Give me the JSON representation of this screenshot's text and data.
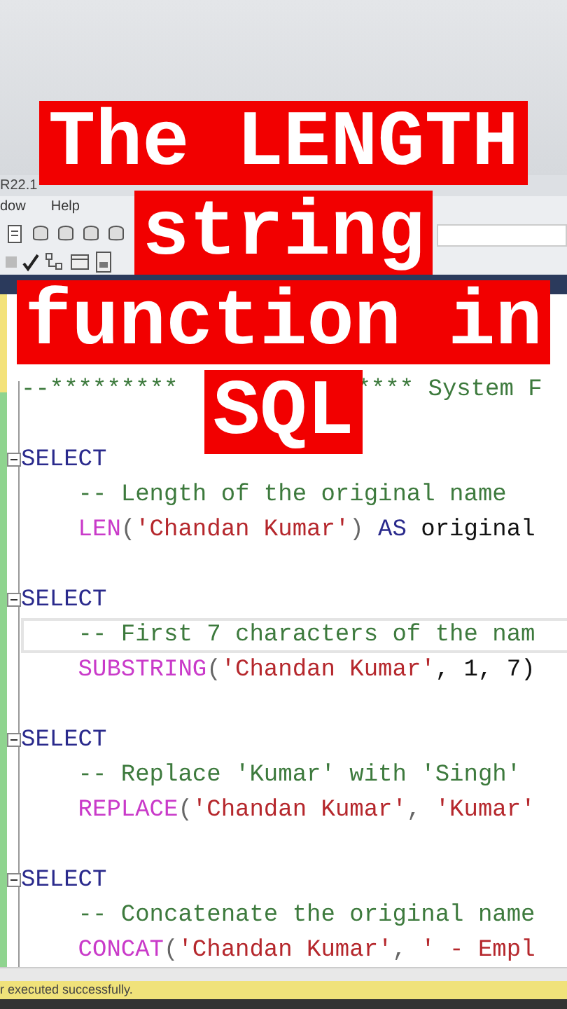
{
  "window": {
    "title": "R22.1"
  },
  "menu": [
    "dow",
    "Help"
  ],
  "caption": {
    "lines": [
      "The LENGTH",
      "string",
      "function in",
      "SQL"
    ]
  },
  "editor": {
    "header": {
      "left": "--*********",
      "right": "**** System F",
      "covered": true
    },
    "blocks": [
      {
        "keyword": "SELECT",
        "collapsed": false,
        "highlighted": false,
        "comment": "-- Length of the original name",
        "code": [
          {
            "kind": "function",
            "text": "LEN"
          },
          {
            "kind": "punct",
            "text": "("
          },
          {
            "kind": "string",
            "text": "'Chandan Kumar'"
          },
          {
            "kind": "punct",
            "text": ") "
          },
          {
            "kind": "keyword",
            "text": "AS"
          },
          {
            "kind": "plain",
            "text": " original"
          }
        ]
      },
      {
        "keyword": "SELECT",
        "collapsed": false,
        "highlighted": true,
        "comment": "-- First 7 characters of the nam",
        "code": [
          {
            "kind": "function",
            "text": "SUBSTRING"
          },
          {
            "kind": "punct",
            "text": "("
          },
          {
            "kind": "string",
            "text": "'Chandan Kumar'"
          },
          {
            "kind": "plain",
            "text": ", 1, 7)"
          }
        ]
      },
      {
        "keyword": "SELECT",
        "collapsed": false,
        "highlighted": false,
        "comment": "-- Replace 'Kumar' with 'Singh'",
        "code": [
          {
            "kind": "function",
            "text": "REPLACE"
          },
          {
            "kind": "punct",
            "text": "("
          },
          {
            "kind": "string",
            "text": "'Chandan Kumar'"
          },
          {
            "kind": "punct",
            "text": ", "
          },
          {
            "kind": "string",
            "text": "'Kumar'"
          }
        ]
      },
      {
        "keyword": "SELECT",
        "collapsed": false,
        "highlighted": false,
        "comment": "-- Concatenate the original name",
        "code": [
          {
            "kind": "function",
            "text": "CONCAT"
          },
          {
            "kind": "punct",
            "text": "("
          },
          {
            "kind": "string",
            "text": "'Chandan Kumar'"
          },
          {
            "kind": "punct",
            "text": ", "
          },
          {
            "kind": "string",
            "text": "' - Empl"
          }
        ]
      }
    ]
  },
  "status_bar": {
    "text": "r executed successfully."
  }
}
